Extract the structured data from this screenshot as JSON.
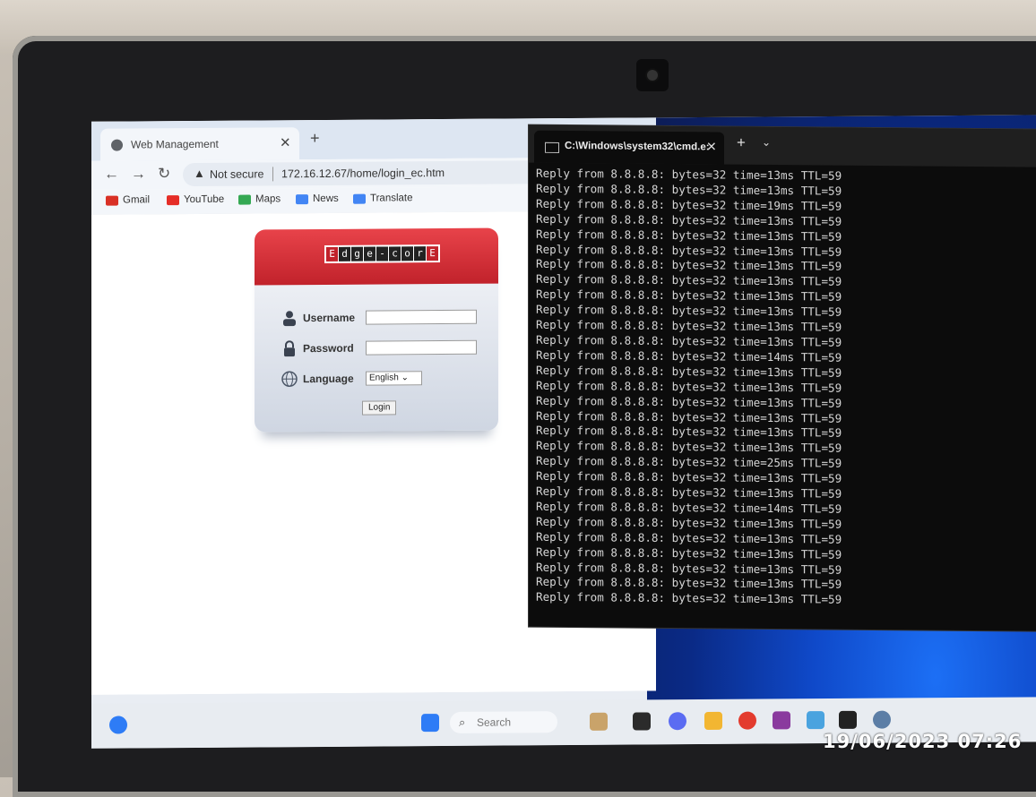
{
  "browser": {
    "tab_title": "Web Management",
    "not_secure": "Not secure",
    "url": "172.16.12.67/home/login_ec.htm",
    "bookmarks": [
      "Gmail",
      "YouTube",
      "Maps",
      "News",
      "Translate"
    ]
  },
  "login": {
    "logo_letters": [
      "E",
      "d",
      "g",
      "e",
      "-",
      "c",
      "o",
      "r",
      "E"
    ],
    "username_label": "Username",
    "password_label": "Password",
    "language_label": "Language",
    "language_value": "English",
    "login_button": "Login"
  },
  "cmd": {
    "tab_title": "C:\\Windows\\system32\\cmd.e:",
    "lines": [
      "Reply from 8.8.8.8: bytes=32 time=13ms TTL=59",
      "Reply from 8.8.8.8: bytes=32 time=13ms TTL=59",
      "Reply from 8.8.8.8: bytes=32 time=19ms TTL=59",
      "Reply from 8.8.8.8: bytes=32 time=13ms TTL=59",
      "Reply from 8.8.8.8: bytes=32 time=13ms TTL=59",
      "Reply from 8.8.8.8: bytes=32 time=13ms TTL=59",
      "Reply from 8.8.8.8: bytes=32 time=13ms TTL=59",
      "Reply from 8.8.8.8: bytes=32 time=13ms TTL=59",
      "Reply from 8.8.8.8: bytes=32 time=13ms TTL=59",
      "Reply from 8.8.8.8: bytes=32 time=13ms TTL=59",
      "Reply from 8.8.8.8: bytes=32 time=13ms TTL=59",
      "Reply from 8.8.8.8: bytes=32 time=13ms TTL=59",
      "Reply from 8.8.8.8: bytes=32 time=14ms TTL=59",
      "Reply from 8.8.8.8: bytes=32 time=13ms TTL=59",
      "Reply from 8.8.8.8: bytes=32 time=13ms TTL=59",
      "Reply from 8.8.8.8: bytes=32 time=13ms TTL=59",
      "Reply from 8.8.8.8: bytes=32 time=13ms TTL=59",
      "Reply from 8.8.8.8: bytes=32 time=13ms TTL=59",
      "Reply from 8.8.8.8: bytes=32 time=13ms TTL=59",
      "Reply from 8.8.8.8: bytes=32 time=25ms TTL=59",
      "Reply from 8.8.8.8: bytes=32 time=13ms TTL=59",
      "Reply from 8.8.8.8: bytes=32 time=13ms TTL=59",
      "Reply from 8.8.8.8: bytes=32 time=14ms TTL=59",
      "Reply from 8.8.8.8: bytes=32 time=13ms TTL=59",
      "Reply from 8.8.8.8: bytes=32 time=13ms TTL=59",
      "Reply from 8.8.8.8: bytes=32 time=13ms TTL=59",
      "Reply from 8.8.8.8: bytes=32 time=13ms TTL=59",
      "Reply from 8.8.8.8: bytes=32 time=13ms TTL=59",
      "Reply from 8.8.8.8: bytes=32 time=13ms TTL=59"
    ]
  },
  "taskbar": {
    "search_placeholder": "Search"
  },
  "photo_timestamp": "19/06/2023  07:26",
  "colors": {
    "edgecore_red": "#c1222b",
    "cmd_bg": "#0c0c0c",
    "wallpaper_blue": "#0f49c9"
  }
}
